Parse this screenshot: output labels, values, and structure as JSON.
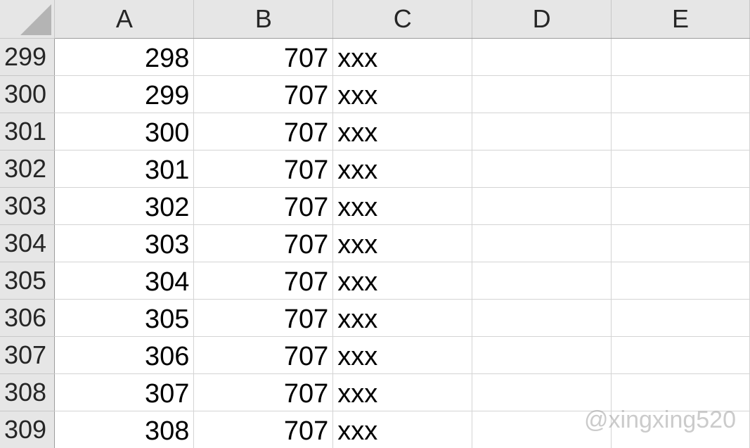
{
  "columns": [
    "A",
    "B",
    "C",
    "D",
    "E"
  ],
  "rows": [
    {
      "num": "299",
      "A": "298",
      "B": "707",
      "C": "xxx",
      "D": "",
      "E": ""
    },
    {
      "num": "300",
      "A": "299",
      "B": "707",
      "C": "xxx",
      "D": "",
      "E": ""
    },
    {
      "num": "301",
      "A": "300",
      "B": "707",
      "C": "xxx",
      "D": "",
      "E": ""
    },
    {
      "num": "302",
      "A": "301",
      "B": "707",
      "C": "xxx",
      "D": "",
      "E": ""
    },
    {
      "num": "303",
      "A": "302",
      "B": "707",
      "C": "xxx",
      "D": "",
      "E": ""
    },
    {
      "num": "304",
      "A": "303",
      "B": "707",
      "C": "xxx",
      "D": "",
      "E": ""
    },
    {
      "num": "305",
      "A": "304",
      "B": "707",
      "C": "xxx",
      "D": "",
      "E": ""
    },
    {
      "num": "306",
      "A": "305",
      "B": "707",
      "C": "xxx",
      "D": "",
      "E": ""
    },
    {
      "num": "307",
      "A": "306",
      "B": "707",
      "C": "xxx",
      "D": "",
      "E": ""
    },
    {
      "num": "308",
      "A": "307",
      "B": "707",
      "C": "xxx",
      "D": "",
      "E": ""
    },
    {
      "num": "309",
      "A": "308",
      "B": "707",
      "C": "xxx",
      "D": "",
      "E": ""
    }
  ],
  "watermark": "@xingxing520",
  "colors": {
    "header_bg": "#e6e6e6",
    "gridline": "#d4d4d4",
    "corner_triangle": "#b4b4b4"
  }
}
